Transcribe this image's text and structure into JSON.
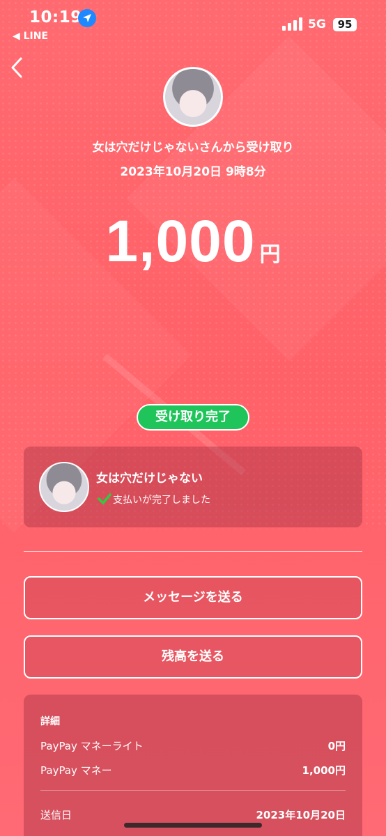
{
  "status_bar": {
    "time": "10:19",
    "back_app": "◀ LINE",
    "network": "5G",
    "battery": "95"
  },
  "header": {
    "sender_text": "女は穴だけじゃないさんから受け取り",
    "datetime": "2023年10月20日 9時8分",
    "amount": "1,000",
    "currency": "円"
  },
  "badge": {
    "label": "受け取り完了",
    "color": "#1fc55a"
  },
  "recipient": {
    "name": "女は穴だけじゃない",
    "status": "支払いが完了しました"
  },
  "buttons": {
    "message": "メッセージを送る",
    "balance": "残高を送る"
  },
  "details": {
    "title": "詳細",
    "rows": [
      {
        "label": "PayPay マネーライト",
        "value": "0円"
      },
      {
        "label": "PayPay マネー",
        "value": "1,000円"
      },
      {
        "label": "送信日",
        "value": "2023年10月20日"
      }
    ]
  },
  "icons": {
    "back": "chevron-left-icon",
    "location": "location-arrow-icon",
    "check": "check-icon"
  },
  "colors": {
    "background": "#ff6168",
    "success": "#1fc55a",
    "check": "#2ecc40"
  }
}
